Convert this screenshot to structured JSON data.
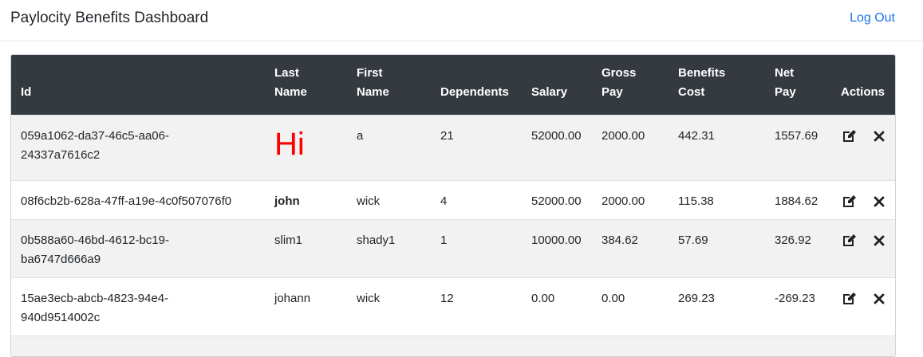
{
  "header": {
    "title": "Paylocity Benefits Dashboard",
    "logout_label": "Log Out"
  },
  "table": {
    "columns": [
      {
        "line1": "",
        "line2": "Id"
      },
      {
        "line1": "Last",
        "line2": "Name"
      },
      {
        "line1": "First",
        "line2": "Name"
      },
      {
        "line1": "",
        "line2": "Dependents"
      },
      {
        "line1": "",
        "line2": "Salary"
      },
      {
        "line1": "Gross",
        "line2": "Pay"
      },
      {
        "line1": "Benefits",
        "line2": "Cost"
      },
      {
        "line1": "Net",
        "line2": "Pay"
      },
      {
        "line1": "",
        "line2": "Actions"
      }
    ],
    "rows": [
      {
        "id_line1": "059a1062-da37-46c5-aa06-",
        "id_line2": "24337a7616c2",
        "last_name": "Hi",
        "first_name": "a",
        "dependents": "21",
        "salary": "52000.00",
        "gross_pay": "2000.00",
        "benefits_cost": "442.31",
        "net_pay": "1557.69"
      },
      {
        "id_line1": "08f6cb2b-628a-47ff-a19e-4c0f507076f0",
        "id_line2": "",
        "last_name": "john",
        "first_name": "wick",
        "dependents": "4",
        "salary": "52000.00",
        "gross_pay": "2000.00",
        "benefits_cost": "115.38",
        "net_pay": "1884.62"
      },
      {
        "id_line1": "0b588a60-46bd-4612-bc19-",
        "id_line2": "ba6747d666a9",
        "last_name": "slim1",
        "first_name": "shady1",
        "dependents": "1",
        "salary": "10000.00",
        "gross_pay": "384.62",
        "benefits_cost": "57.69",
        "net_pay": "326.92"
      },
      {
        "id_line1": "15ae3ecb-abcb-4823-94e4-",
        "id_line2": "940d9514002c",
        "last_name": "johann",
        "first_name": "wick",
        "dependents": "12",
        "salary": "0.00",
        "gross_pay": "0.00",
        "benefits_cost": "269.23",
        "net_pay": "-269.23"
      }
    ],
    "actions": {
      "edit_icon": "edit-icon",
      "delete_icon": "close-icon"
    }
  }
}
